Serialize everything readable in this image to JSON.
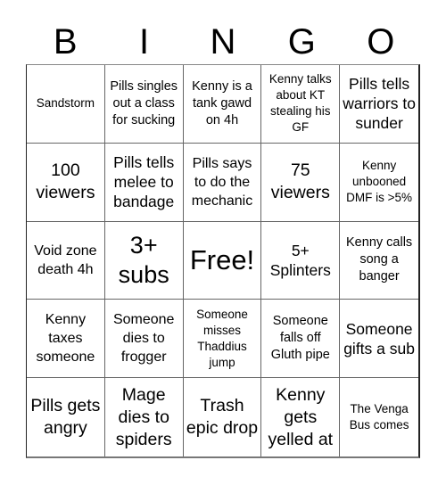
{
  "title": [
    "B",
    "I",
    "N",
    "G",
    "O"
  ],
  "cells": [
    {
      "text": "Sandstorm",
      "size": "fs-13"
    },
    {
      "text": "Pills singles out a class for sucking",
      "size": "fs-14"
    },
    {
      "text": "Kenny is a tank gawd on 4h",
      "size": "fs-14"
    },
    {
      "text": "Kenny talks about KT stealing his GF",
      "size": "fs-13"
    },
    {
      "text": "Pills tells warriors to sunder",
      "size": "fs-17"
    },
    {
      "text": "100 viewers",
      "size": "fs-19"
    },
    {
      "text": "Pills tells melee to bandage",
      "size": "fs-17"
    },
    {
      "text": "Pills says to do the mechanic",
      "size": "fs-15"
    },
    {
      "text": "75 viewers",
      "size": "fs-19"
    },
    {
      "text": "Kenny unbooned DMF is >5%",
      "size": "fs-13"
    },
    {
      "text": "Void zone death 4h",
      "size": "fs-15"
    },
    {
      "text": "3+ subs",
      "size": "fs-27"
    },
    {
      "text": "Free!",
      "size": "fs-31"
    },
    {
      "text": "5+ Splinters",
      "size": "fs-17"
    },
    {
      "text": "Kenny calls song a banger",
      "size": "fs-14"
    },
    {
      "text": "Kenny taxes someone",
      "size": "fs-15"
    },
    {
      "text": "Someone dies to frogger",
      "size": "fs-15"
    },
    {
      "text": "Someone misses Thaddius jump",
      "size": "fs-13"
    },
    {
      "text": "Someone falls off Gluth pipe",
      "size": "fs-14"
    },
    {
      "text": "Someone gifts a sub",
      "size": "fs-17"
    },
    {
      "text": "Pills gets angry",
      "size": "fs-19"
    },
    {
      "text": "Mage dies to spiders",
      "size": "fs-19"
    },
    {
      "text": "Trash epic drop",
      "size": "fs-19"
    },
    {
      "text": "Kenny gets yelled at",
      "size": "fs-19"
    },
    {
      "text": "The Venga Bus comes",
      "size": "fs-13"
    }
  ]
}
